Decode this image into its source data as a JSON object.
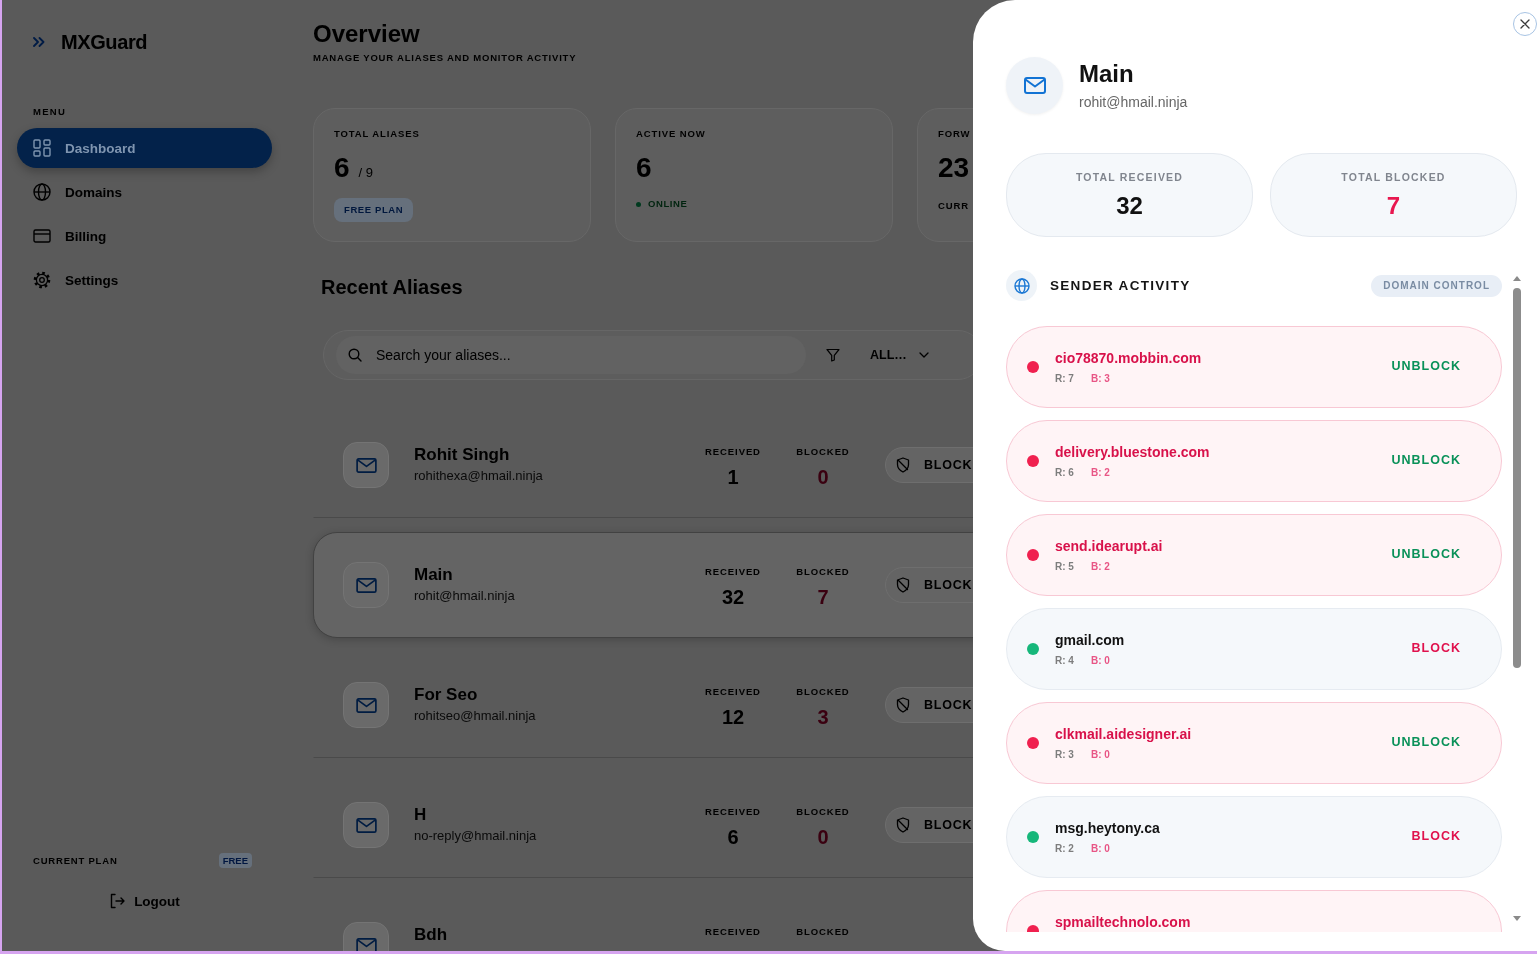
{
  "sidebar": {
    "brand": "MXGuard",
    "menu_label": "MENU",
    "items": [
      {
        "label": "Dashboard",
        "selected": true
      },
      {
        "label": "Domains",
        "selected": false
      },
      {
        "label": "Billing",
        "selected": false
      },
      {
        "label": "Settings",
        "selected": false
      }
    ],
    "plan": {
      "label": "CURRENT PLAN",
      "badge": "FREE"
    },
    "logout": "Logout"
  },
  "header": {
    "title": "Overview",
    "subtitle": "MANAGE YOUR ALIASES AND MONITOR ACTIVITY"
  },
  "stats": [
    {
      "kind": "plan",
      "label": "TOTAL ALIASES",
      "value": "6",
      "limit": "/ 9",
      "badge": "FREE PLAN"
    },
    {
      "kind": "status",
      "label": "ACTIVE NOW",
      "value": "6",
      "status": "ONLINE"
    },
    {
      "kind": "note",
      "label": "FORW",
      "value": "23",
      "note": "CURR"
    }
  ],
  "recent": {
    "title": "Recent Aliases",
    "search": {
      "placeholder": "Search your aliases..."
    },
    "filter": {
      "value": "ALL…"
    },
    "aliases": [
      {
        "name": "Rohit Singh",
        "email": "rohithexa@hmail.ninja",
        "received_label": "RECEIVED",
        "received": "1",
        "blocked_label": "BLOCKED",
        "blocked_count": "0",
        "action": "BLOCK",
        "selected": false
      },
      {
        "name": "Main",
        "email": "rohit@hmail.ninja",
        "received_label": "RECEIVED",
        "received": "32",
        "blocked_label": "BLOCKED",
        "blocked_count": "7",
        "action": "BLOCK",
        "selected": true
      },
      {
        "name": "For Seo",
        "email": "rohitseo@hmail.ninja",
        "received_label": "RECEIVED",
        "received": "12",
        "blocked_label": "BLOCKED",
        "blocked_count": "3",
        "action": "BLOCK",
        "selected": false
      },
      {
        "name": "H",
        "email": "no-reply@hmail.ninja",
        "received_label": "RECEIVED",
        "received": "6",
        "blocked_label": "BLOCKED",
        "blocked_count": "0",
        "action": "BLOCK",
        "selected": false
      },
      {
        "name": "Bdh",
        "received_label": "RECEIVED",
        "blocked_label": "BLOCKED",
        "selected": false
      }
    ]
  },
  "drawer": {
    "title": "Main",
    "email": "rohit@hmail.ninja",
    "totals": [
      {
        "kind": "received",
        "label": "TOTAL RECEIVED",
        "value": "32"
      },
      {
        "kind": "blocked",
        "label": "TOTAL BLOCKED",
        "value": "7"
      }
    ],
    "activity": {
      "title": "SENDER ACTIVITY",
      "badge": "DOMAIN CONTROL",
      "senders": [
        {
          "domain": "cio78870.mobbin.com",
          "received": "R: 7",
          "blocked_count": "B: 3",
          "blocked": true,
          "action": "UNBLOCK"
        },
        {
          "domain": "delivery.bluestone.com",
          "received": "R: 6",
          "blocked_count": "B: 2",
          "blocked": true,
          "action": "UNBLOCK"
        },
        {
          "domain": "send.idearupt.ai",
          "received": "R: 5",
          "blocked_count": "B: 2",
          "blocked": true,
          "action": "UNBLOCK"
        },
        {
          "domain": "gmail.com",
          "received": "R: 4",
          "blocked_count": "B: 0",
          "blocked": false,
          "action": "BLOCK"
        },
        {
          "domain": "clkmail.aidesigner.ai",
          "received": "R: 3",
          "blocked_count": "B: 0",
          "blocked": true,
          "action": "UNBLOCK"
        },
        {
          "domain": "msg.heytony.ca",
          "received": "R: 2",
          "blocked_count": "B: 0",
          "blocked": false,
          "action": "BLOCK"
        },
        {
          "domain": "spmailtechnolo.com",
          "blocked": true
        }
      ]
    }
  }
}
